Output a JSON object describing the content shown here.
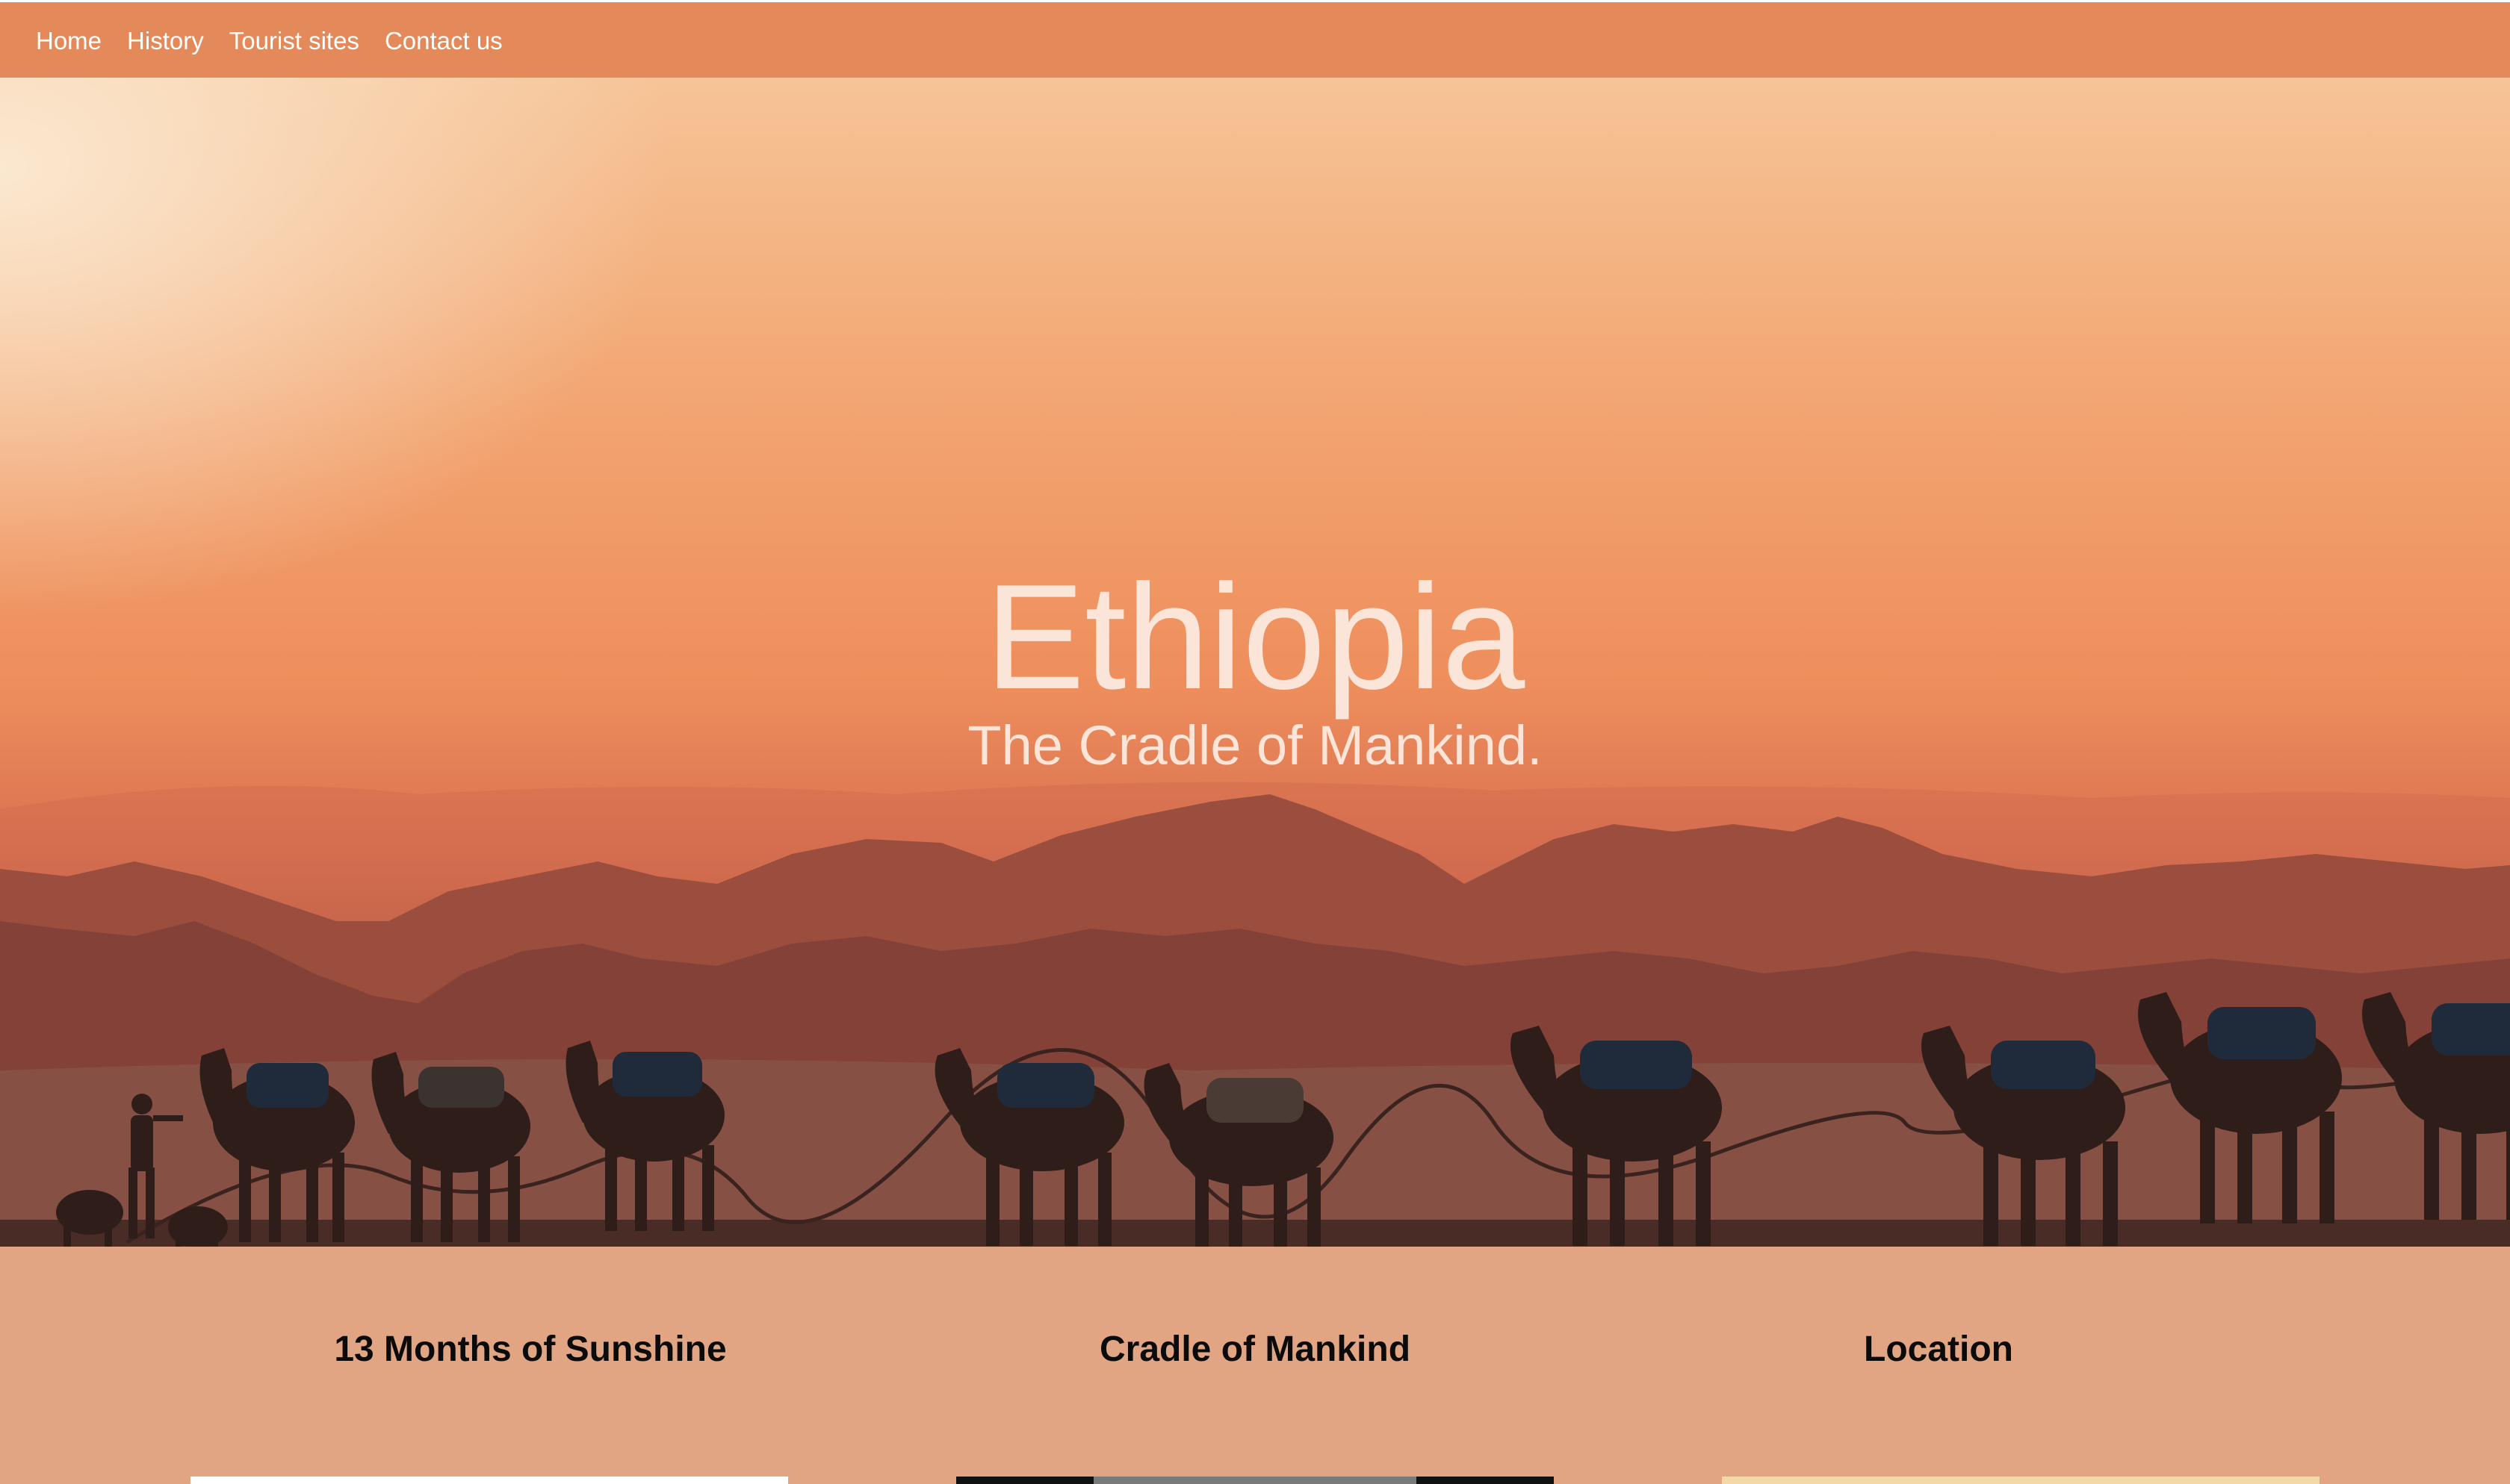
{
  "nav": {
    "items": [
      {
        "label": "Home"
      },
      {
        "label": "History"
      },
      {
        "label": "Tourist sites"
      },
      {
        "label": "Contact us"
      }
    ]
  },
  "hero": {
    "title": "Ethiopia",
    "subtitle": "The Cradle of Mankind."
  },
  "features": [
    {
      "title": "13 Months of Sunshine"
    },
    {
      "title": "Cradle of Mankind"
    },
    {
      "title": "Location"
    }
  ],
  "colors": {
    "navbar": "#e48a5a",
    "section_bg": "#e1a583",
    "hero_text": "#fbe4d8"
  }
}
